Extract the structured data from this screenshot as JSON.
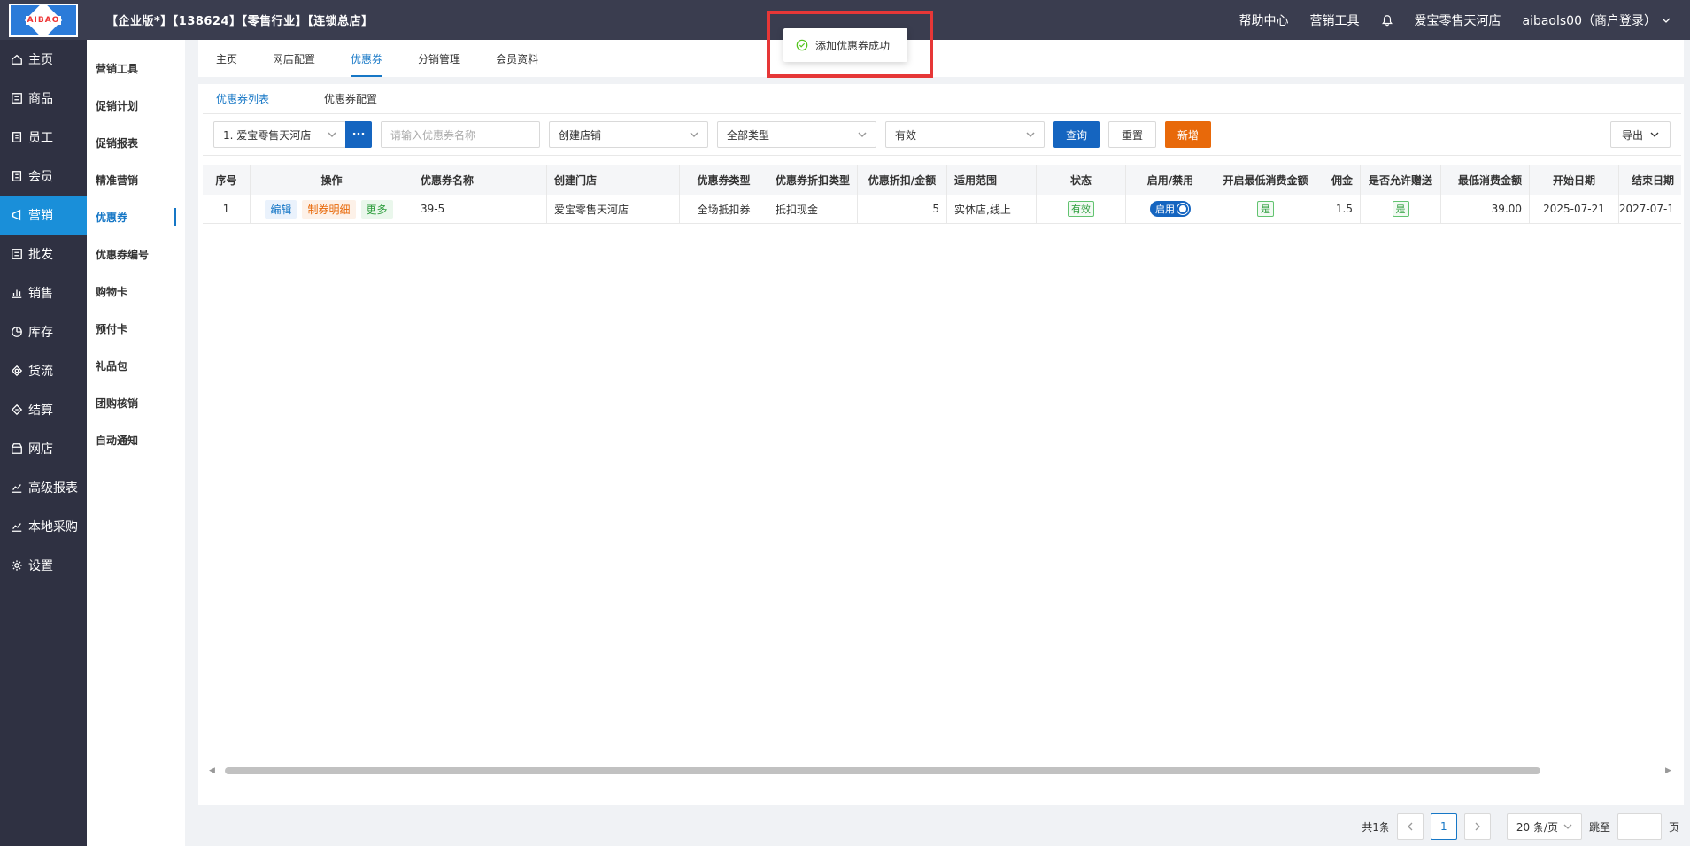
{
  "topbar": {
    "logo_text": "AIBAO",
    "title": "【企业版*】【138624】【零售行业】【连锁总店】",
    "help": "帮助中心",
    "marketing_tools": "营销工具",
    "store": "爱宝零售天河店",
    "user": "aibaols00（商户登录）"
  },
  "leftnav": [
    {
      "label": "主页",
      "icon": "home-icon"
    },
    {
      "label": "商品",
      "icon": "goods-icon"
    },
    {
      "label": "员工",
      "icon": "staff-icon"
    },
    {
      "label": "会员",
      "icon": "member-icon"
    },
    {
      "label": "营销",
      "icon": "marketing-icon"
    },
    {
      "label": "批发",
      "icon": "wholesale-icon"
    },
    {
      "label": "销售",
      "icon": "sales-icon"
    },
    {
      "label": "库存",
      "icon": "inventory-icon"
    },
    {
      "label": "货流",
      "icon": "logistics-icon"
    },
    {
      "label": "结算",
      "icon": "settlement-icon"
    },
    {
      "label": "网店",
      "icon": "shop-icon"
    },
    {
      "label": "高级报表",
      "icon": "report-icon"
    },
    {
      "label": "本地采购",
      "icon": "purchase-icon"
    },
    {
      "label": "设置",
      "icon": "settings-icon"
    }
  ],
  "subnav": [
    "营销工具",
    "促销计划",
    "促销报表",
    "精准营销",
    "优惠券",
    "优惠券编号",
    "购物卡",
    "预付卡",
    "礼品包",
    "团购核销",
    "自动通知"
  ],
  "maintabs": [
    "主页",
    "网店配置",
    "优惠券",
    "分销管理",
    "会员资料"
  ],
  "subtabs": [
    "优惠券列表",
    "优惠券配置"
  ],
  "filters": {
    "store_select": "1. 爱宝零售天河店",
    "dots": "···",
    "name_placeholder": "请输入优惠券名称",
    "create_store_placeholder": "创建店铺",
    "type": "全部类型",
    "status": "有效",
    "query": "查询",
    "reset": "重置",
    "add": "新增",
    "export": "导出"
  },
  "table": {
    "headers": [
      "序号",
      "操作",
      "优惠券名称",
      "创建门店",
      "优惠券类型",
      "优惠券折扣类型",
      "优惠折扣/金额",
      "适用范围",
      "状态",
      "启用/禁用",
      "开启最低消费金额",
      "佣金",
      "是否允许赠送",
      "最低消费金额",
      "开始日期",
      "结束日期"
    ],
    "rows": [
      {
        "index": "1",
        "op_edit": "编辑",
        "op_detail": "制券明细",
        "op_more": "更多",
        "name": "39-5",
        "store": "爱宝零售天河店",
        "type": "全场抵扣券",
        "discount_type": "抵扣现金",
        "amount": "5",
        "scope": "实体店,线上",
        "status": "有效",
        "toggle": "启用",
        "min_enabled": "是",
        "commission": "1.5",
        "gift": "是",
        "min_amount": "39.00",
        "start": "2025-07-21",
        "end": "2027-07-1"
      }
    ]
  },
  "pager": {
    "total": "共1条",
    "current": "1",
    "page_size": "20 条/页",
    "jump": "跳至",
    "page_unit": "页"
  },
  "toast": "添加优惠券成功"
}
